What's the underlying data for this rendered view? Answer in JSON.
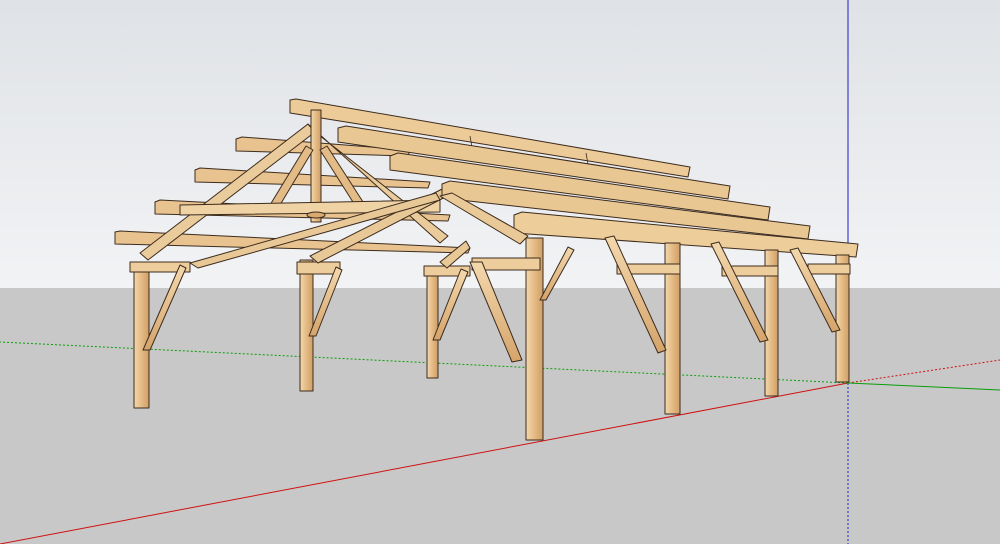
{
  "app": {
    "view": "3d-modeling-viewport",
    "model_subject": "timber-frame-pavilion"
  },
  "colors": {
    "sky_top": "#dfe2e6",
    "sky_bottom": "#f2f3f5",
    "ground": "#c8c8c8",
    "wood_light": "#efd1a1",
    "wood_mid": "#e1b57d",
    "wood_dark": "#a57b4c",
    "edge": "#3d2c1e",
    "axis_red": "#d01010",
    "axis_green": "#0a9d0a",
    "axis_blue": "#1c1cc8"
  },
  "axes": {
    "red": "x-axis",
    "green": "y-axis",
    "blue": "z-axis"
  },
  "structure": {
    "bents": 4,
    "purlins_per_side": 5,
    "posts_per_bent": 2
  }
}
